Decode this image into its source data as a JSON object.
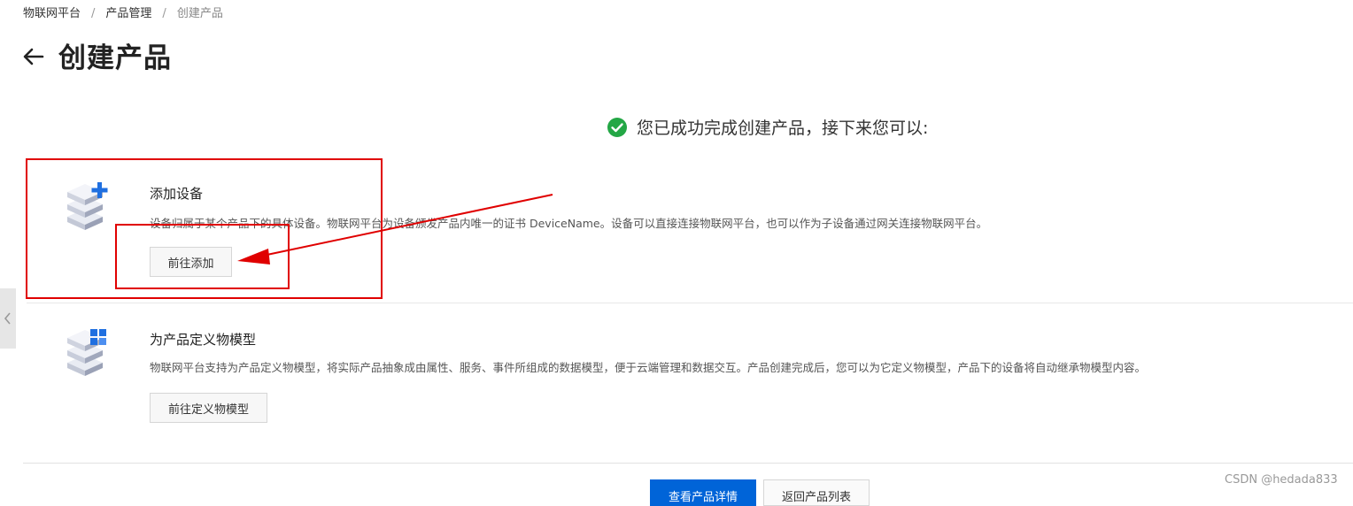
{
  "breadcrumb": {
    "items": [
      "物联网平台",
      "产品管理"
    ],
    "separator": "/",
    "current": "创建产品"
  },
  "header": {
    "title": "创建产品"
  },
  "success": {
    "message": "您已成功完成创建产品，接下来您可以:"
  },
  "cards": [
    {
      "title": "添加设备",
      "description": "设备归属于某个产品下的具体设备。物联网平台为设备颁发产品内唯一的证书 DeviceName。设备可以直接连接物联网平台，也可以作为子设备通过网关连接物联网平台。",
      "button": "前往添加",
      "icon": "add-device-icon"
    },
    {
      "title": "为产品定义物模型",
      "description": "物联网平台支持为产品定义物模型，将实际产品抽象成由属性、服务、事件所组成的数据模型，便于云端管理和数据交互。产品创建完成后，您可以为它定义物模型，产品下的设备将自动继承物模型内容。",
      "button": "前往定义物模型",
      "icon": "thing-model-icon"
    }
  ],
  "footer": {
    "primary_button": "查看产品详情",
    "secondary_button": "返回产品列表"
  },
  "watermark": "CSDN @hedada833",
  "colors": {
    "accent": "#0064d8",
    "success": "#23a745",
    "annotation": "#e00000"
  }
}
